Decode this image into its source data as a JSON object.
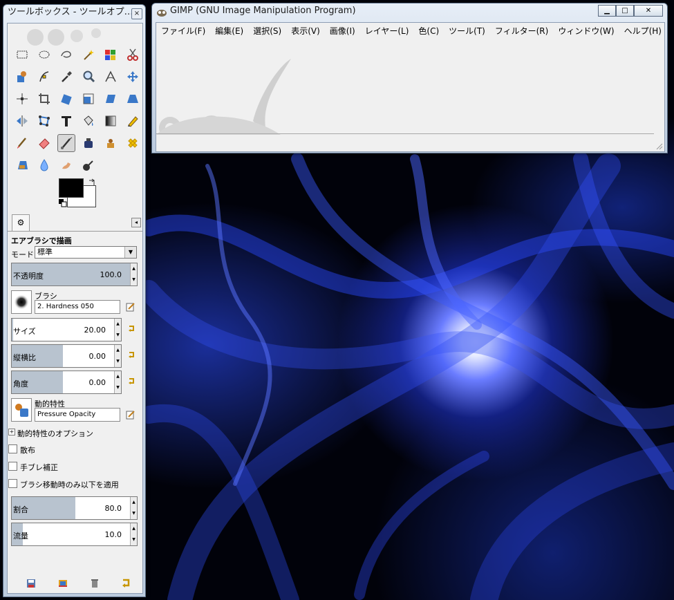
{
  "toolbox": {
    "title": "ツールボックス - ツールオプ…",
    "close_glyph": "×",
    "tools": [
      "rect-select-icon",
      "ellipse-select-icon",
      "free-select-icon",
      "fuzzy-select-icon",
      "color-select-icon",
      "scissors-select-icon",
      "foreground-select-icon",
      "paths-icon",
      "color-picker-icon",
      "zoom-icon",
      "measure-icon",
      "move-icon",
      "align-icon",
      "crop-icon",
      "rotate-icon",
      "scale-icon",
      "shear-icon",
      "perspective-icon",
      "flip-icon",
      "cage-transform-icon",
      "text-icon",
      "bucket-fill-icon",
      "blend-icon",
      "pencil-icon",
      "paintbrush-icon",
      "eraser-icon",
      "airbrush-icon",
      "ink-icon",
      "clone-icon",
      "heal-icon",
      "perspective-clone-icon",
      "blur-icon",
      "smudge-icon",
      "dodge-burn-icon"
    ],
    "active_tool_index": 26,
    "tool_options": {
      "title": "エアブラシで描画",
      "mode_label": "モード:",
      "mode_value": "標準",
      "opacity_label": "不透明度",
      "opacity_value": "100.0",
      "brush_label": "ブラシ",
      "brush_value": "2. Hardness 050",
      "size_label": "サイズ",
      "size_value": "20.00",
      "aspect_label": "縦横比",
      "aspect_value": "0.00",
      "angle_label": "角度",
      "angle_value": "0.00",
      "dynamics_label": "動的特性",
      "dynamics_value": "Pressure Opacity",
      "dynamics_options_label": "動的特性のオプション",
      "scatter_label": "散布",
      "smoothing_label": "手ブレ補正",
      "incremental_label": "ブラシ移動時のみ以下を適用",
      "rate_label": "割合",
      "rate_value": "80.0",
      "flow_label": "流量",
      "flow_value": "10.0"
    }
  },
  "gimp": {
    "title": "GIMP (GNU Image Manipulation Program)",
    "minimize": "▁",
    "maximize": "□",
    "close": "✕",
    "menus": [
      "ファイル(F)",
      "編集(E)",
      "選択(S)",
      "表示(V)",
      "画像(I)",
      "レイヤー(L)",
      "色(C)",
      "ツール(T)",
      "フィルター(R)",
      "ウィンドウ(W)",
      "ヘルプ(H)"
    ]
  },
  "colors": {
    "foreground": "#000000",
    "background": "#ffffff",
    "desktop": "#01020a",
    "accent_blue": "#2a4bff"
  }
}
